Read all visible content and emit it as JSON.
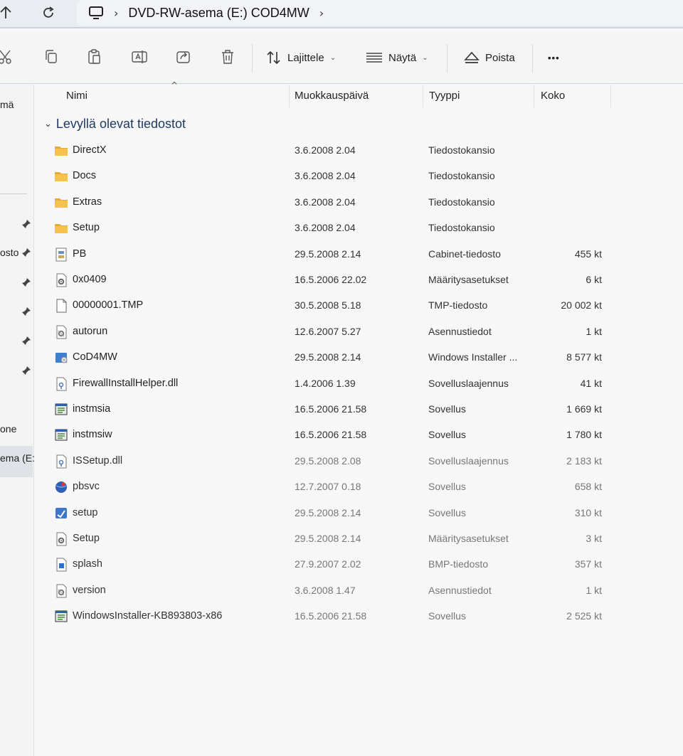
{
  "addressbar": {
    "path_segments": [
      "DVD-RW-asema (E:) COD4MW"
    ]
  },
  "toolbar": {
    "sort_label": "Lajittele",
    "view_label": "Näytä",
    "eject_label": "Poista",
    "more_label": "•••"
  },
  "sidebar": {
    "items": [
      {
        "label": "mä"
      },
      {
        "label": "osto"
      },
      {
        "label": "one"
      },
      {
        "label": "ema (E:"
      }
    ]
  },
  "columns": {
    "name": "Nimi",
    "modified": "Muokkauspäivä",
    "type": "Tyyppi",
    "size": "Koko"
  },
  "group": {
    "title": "Levyllä olevat tiedostot"
  },
  "files": [
    {
      "name": "DirectX",
      "date": "3.6.2008 2.04",
      "type": "Tiedostokansio",
      "size": "",
      "icon": "folder-icon"
    },
    {
      "name": "Docs",
      "date": "3.6.2008 2.04",
      "type": "Tiedostokansio",
      "size": "",
      "icon": "folder-icon"
    },
    {
      "name": "Extras",
      "date": "3.6.2008 2.04",
      "type": "Tiedostokansio",
      "size": "",
      "icon": "folder-icon"
    },
    {
      "name": "Setup",
      "date": "3.6.2008 2.04",
      "type": "Tiedostokansio",
      "size": "",
      "icon": "folder-icon"
    },
    {
      "name": "PB",
      "date": "29.5.2008 2.14",
      "type": "Cabinet-tiedosto",
      "size": "455 kt",
      "icon": "cabinet-file-icon"
    },
    {
      "name": "0x0409",
      "date": "16.5.2006 22.02",
      "type": "Määritysasetukset",
      "size": "6 kt",
      "icon": "settings-file-icon"
    },
    {
      "name": "00000001.TMP",
      "date": "30.5.2008 5.18",
      "type": "TMP-tiedosto",
      "size": "20 002 kt",
      "icon": "blank-file-icon"
    },
    {
      "name": "autorun",
      "date": "12.6.2007 5.27",
      "type": "Asennustiedot",
      "size": "1 kt",
      "icon": "setup-info-icon"
    },
    {
      "name": "CoD4MW",
      "date": "29.5.2008 2.14",
      "type": "Windows Installer ...",
      "size": "8 577 kt",
      "icon": "installer-package-icon"
    },
    {
      "name": "FirewallInstallHelper.dll",
      "date": "1.4.2006 1.39",
      "type": "Sovelluslaajennus",
      "size": "41 kt",
      "icon": "dll-file-icon"
    },
    {
      "name": "instmsia",
      "date": "16.5.2006 21.58",
      "type": "Sovellus",
      "size": "1 669 kt",
      "icon": "application-icon"
    },
    {
      "name": "instmsiw",
      "date": "16.5.2006 21.58",
      "type": "Sovellus",
      "size": "1 780 kt",
      "icon": "application-icon"
    },
    {
      "name": "ISSetup.dll",
      "date": "29.5.2008 2.08",
      "type": "Sovelluslaajennus",
      "size": "2 183 kt",
      "icon": "dll-file-icon"
    },
    {
      "name": "pbsvc",
      "date": "12.7.2007 0.18",
      "type": "Sovellus",
      "size": "658 kt",
      "icon": "globe-app-icon"
    },
    {
      "name": "setup",
      "date": "29.5.2008 2.14",
      "type": "Sovellus",
      "size": "310 kt",
      "icon": "setup-app-icon"
    },
    {
      "name": "Setup",
      "date": "29.5.2008 2.14",
      "type": "Määritysasetukset",
      "size": "3 kt",
      "icon": "settings-file-icon"
    },
    {
      "name": "splash",
      "date": "27.9.2007 2.02",
      "type": "BMP-tiedosto",
      "size": "357 kt",
      "icon": "image-file-icon"
    },
    {
      "name": "version",
      "date": "3.6.2008 1.47",
      "type": "Asennustiedot",
      "size": "1 kt",
      "icon": "setup-info-icon"
    },
    {
      "name": "WindowsInstaller-KB893803-x86",
      "date": "16.5.2006 21.58",
      "type": "Sovellus",
      "size": "2 525 kt",
      "icon": "application-icon"
    }
  ]
}
